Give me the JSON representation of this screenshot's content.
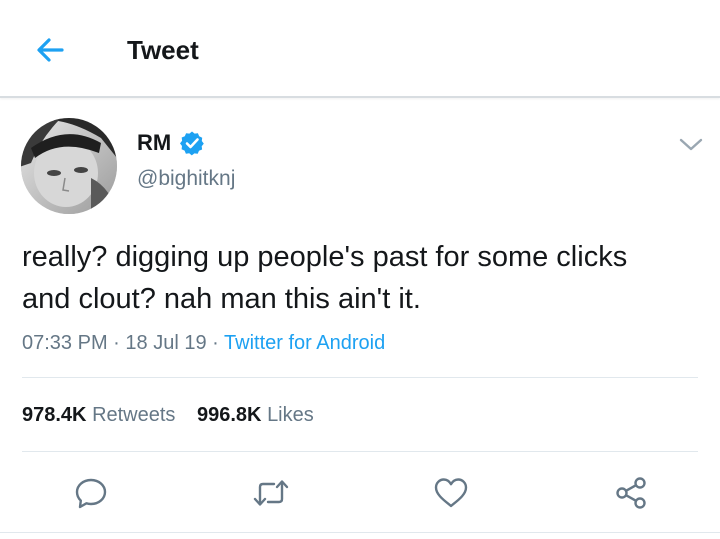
{
  "header": {
    "title": "Tweet",
    "back_icon": "arrow-left-icon",
    "accent_color": "#1da1f2"
  },
  "tweet": {
    "author": {
      "display_name": "RM",
      "handle": "@bighitknj",
      "verified": true
    },
    "text": "really? digging up people's past for some clicks\nand clout? nah man this ain't it.",
    "time": "07:33 PM",
    "date": "18 Jul 19",
    "source": "Twitter for Android",
    "separator": "·"
  },
  "stats": {
    "retweets_count": "978.4K",
    "retweets_label": "Retweets",
    "likes_count": "996.8K",
    "likes_label": "Likes"
  },
  "actions": [
    "reply-icon",
    "retweet-icon",
    "like-icon",
    "share-icon"
  ]
}
